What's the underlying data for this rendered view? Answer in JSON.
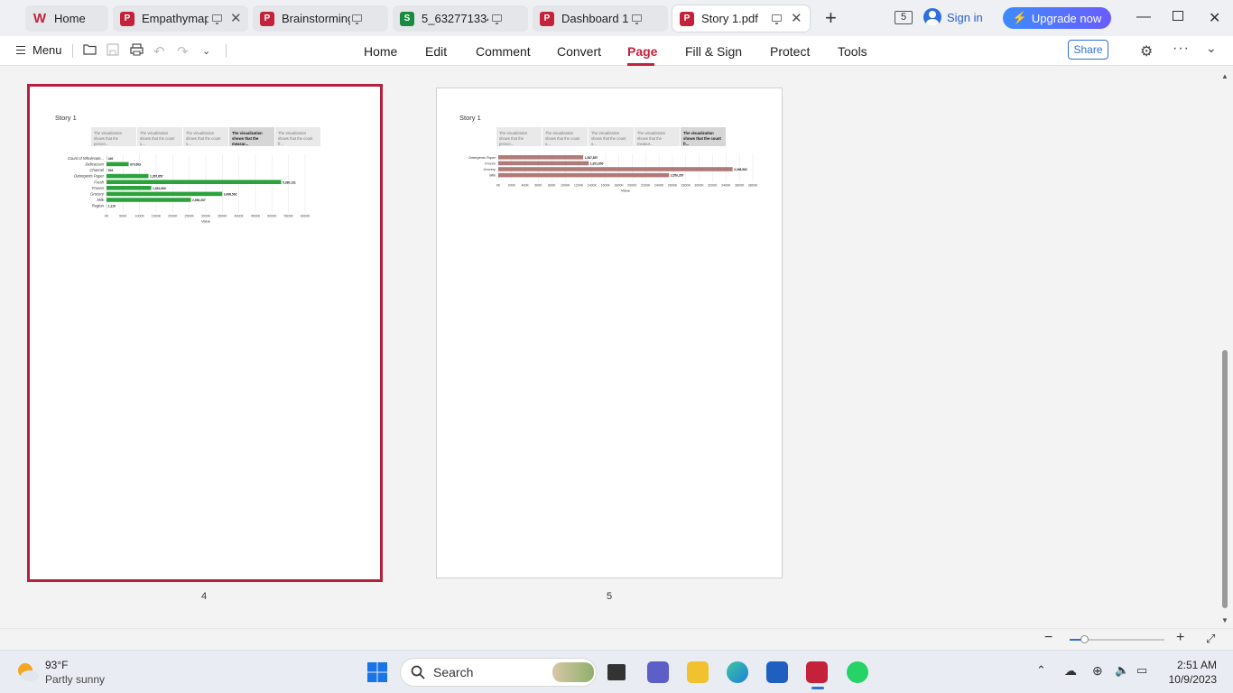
{
  "tabs": [
    {
      "label": "Home",
      "icon": "wps-logo-icon"
    },
    {
      "label": "Empathymap",
      "icon": "pdf-icon"
    },
    {
      "label": "Brainstorming",
      "icon": "pdf-icon"
    },
    {
      "label": "5_6327713349",
      "icon": "sheet-icon"
    },
    {
      "label": "Dashboard 1",
      "icon": "pdf-icon"
    },
    {
      "label": "Story 1.pdf",
      "icon": "pdf-icon"
    }
  ],
  "header": {
    "tab_count": "5",
    "sign_in": "Sign in",
    "upgrade": "Upgrade now"
  },
  "toolbar": {
    "menu": "Menu",
    "nav": [
      "Home",
      "Edit",
      "Comment",
      "Convert",
      "Page",
      "Fill & Sign",
      "Protect",
      "Tools"
    ],
    "active_nav": "Page",
    "share": "Share"
  },
  "pages": [
    {
      "number": "4",
      "story_title": "Story 1",
      "captions": [
        "The visualization shows that the percen...",
        "The visualization shows that the count o...",
        "The visualization shows that the count o...",
        "The visualization shows that the measur...",
        "The visualization shows that the count fr..."
      ]
    },
    {
      "number": "5",
      "story_title": "Story 1",
      "captions": [
        "The visualization shows that the percen...",
        "The visualization shows that the count o...",
        "The visualization shows that the count o...",
        "The visualization shows that the measur...",
        "The visualization shows that the count fr..."
      ]
    }
  ],
  "chart_data": [
    {
      "type": "bar",
      "orientation": "horizontal",
      "categories": [
        "Count of Wholesale...",
        "Delicassen",
        "Channel",
        "Detergents Paper",
        "Fresh",
        "Frozen",
        "Grocery",
        "Milk",
        "Region"
      ],
      "values": [
        440,
        670503,
        592,
        1267857,
        5280131,
        1351650,
        3498562,
        2550357,
        1119
      ],
      "data_labels": [
        "440",
        "670,503",
        "592",
        "1,267,857",
        "5,280,131",
        "1,351,650",
        "3,498,562",
        "2,550,357",
        "1,119"
      ],
      "ticks": [
        "0K",
        "500K",
        "1000K",
        "1500K",
        "2000K",
        "2500K",
        "3000K",
        "3500K",
        "4000K",
        "4500K",
        "5000K",
        "5500K",
        "6000K"
      ],
      "xlabel": "Value",
      "xlim": [
        0,
        6000000
      ],
      "color": "#2aa33c"
    },
    {
      "type": "bar",
      "orientation": "horizontal",
      "categories": [
        "Detergents Paper",
        "Frozen",
        "Grocery",
        "Milk"
      ],
      "values": [
        1267857,
        1351650,
        3498562,
        2550357
      ],
      "data_labels": [
        "1,267,857",
        "1,351,650",
        "3,498,562",
        "2,550,357"
      ],
      "ticks": [
        "0K",
        "200K",
        "400K",
        "600K",
        "800K",
        "1000K",
        "1200K",
        "1400K",
        "1600K",
        "1800K",
        "2000K",
        "2200K",
        "2400K",
        "2600K",
        "2800K",
        "3000K",
        "3200K",
        "3400K",
        "3600K",
        "3800K"
      ],
      "xlabel": "Value",
      "xlim": [
        0,
        3800000
      ],
      "color": "#b07a78"
    }
  ],
  "zoom": {
    "level": 0.15
  },
  "taskbar": {
    "temperature": "93°F",
    "condition": "Partly sunny",
    "search": "Search",
    "time": "2:51 AM",
    "date": "10/9/2023"
  }
}
